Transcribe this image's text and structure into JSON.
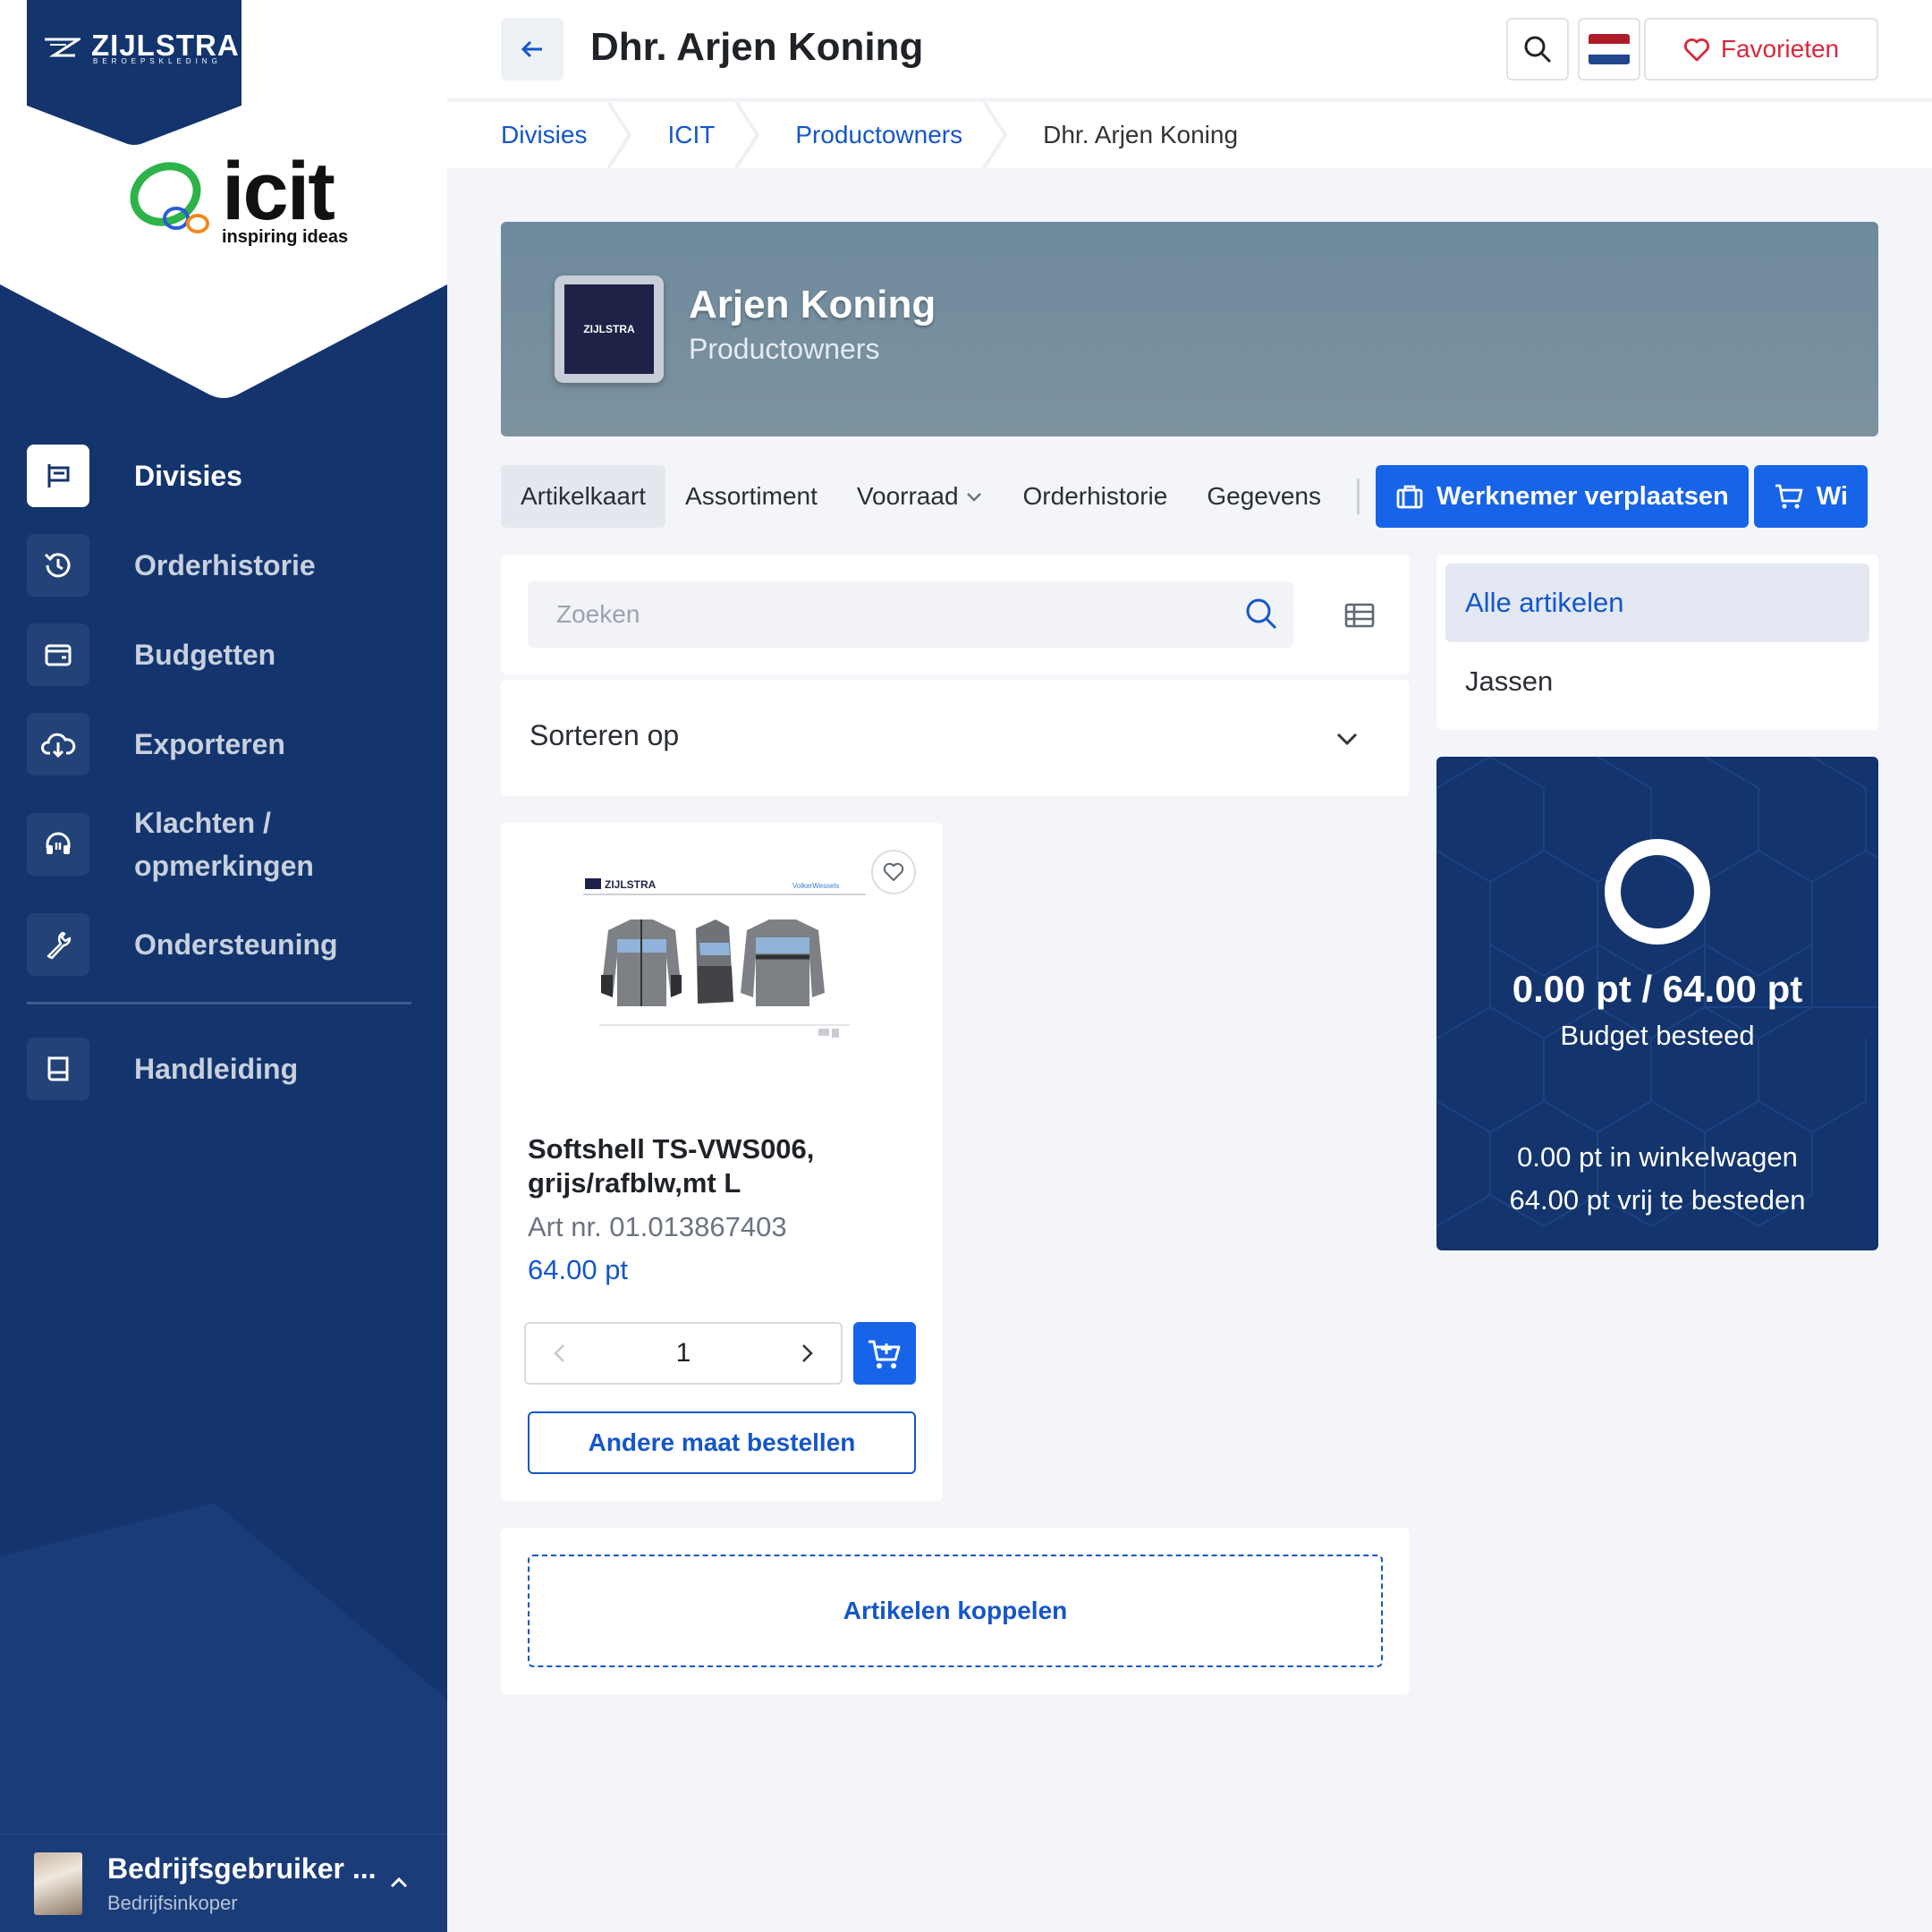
{
  "brand": {
    "name": "ZIJLSTRA",
    "tagline": "BEROEPSKLEDING"
  },
  "client_logo": {
    "name": "icit",
    "tagline": "inspiring ideas"
  },
  "sidebar": {
    "items": [
      {
        "label": "Divisies",
        "icon": "flag-icon",
        "active": true
      },
      {
        "label": "Orderhistorie",
        "icon": "history-icon"
      },
      {
        "label": "Budgetten",
        "icon": "wallet-icon"
      },
      {
        "label": "Exporteren",
        "icon": "cloud-download-icon"
      },
      {
        "label": "Klachten / opmerkingen",
        "icon": "headset-icon"
      },
      {
        "label": "Ondersteuning",
        "icon": "wrench-icon"
      }
    ],
    "secondary": [
      {
        "label": "Handleiding",
        "icon": "book-icon"
      }
    ],
    "user": {
      "name": "Bedrijfsgebruiker ...",
      "role": "Bedrijfsinkoper"
    }
  },
  "header": {
    "title": "Dhr. Arjen Koning",
    "favorites_label": "Favorieten",
    "language": "nl"
  },
  "breadcrumb": [
    "Divisies",
    "ICIT",
    "Productowners",
    "Dhr. Arjen Koning"
  ],
  "profile": {
    "name": "Arjen Koning",
    "group": "Productowners",
    "logo_text": "ZIJLSTRA"
  },
  "tabs": [
    {
      "label": "Artikelkaart",
      "active": true
    },
    {
      "label": "Assortiment"
    },
    {
      "label": "Voorraad",
      "dropdown": true
    },
    {
      "label": "Orderhistorie"
    },
    {
      "label": "Gegevens"
    }
  ],
  "actions": {
    "move_employee": "Werknemer verplaatsen",
    "cart_truncated": "Wi"
  },
  "search": {
    "placeholder": "Zoeken"
  },
  "sort": {
    "label": "Sorteren op"
  },
  "product": {
    "name": "Softshell TS-VWS006, grijs/rafblw,mt L",
    "article_no": "Art nr. 01.013867403",
    "price": "64.00 pt",
    "quantity": "1",
    "other_size": "Andere maat bestellen",
    "image_brand": "ZIJLSTRA",
    "image_client": "VolkerWessels"
  },
  "link_articles": "Artikelen koppelen",
  "filters": [
    {
      "label": "Alle artikelen",
      "active": true
    },
    {
      "label": "Jassen"
    }
  ],
  "budget": {
    "spent": "0.00 pt / 64.00 pt",
    "spent_label": "Budget besteed",
    "in_cart": "0.00 pt in winkelwagen",
    "free": "64.00 pt vrij te besteden",
    "progress_fraction": 0
  },
  "colors": {
    "sidebar": "#13346d",
    "primary": "#1764e8",
    "link": "#1556c9",
    "favorite": "#d8283d"
  }
}
